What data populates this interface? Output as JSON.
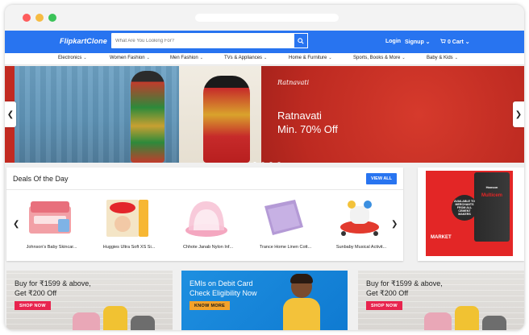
{
  "header": {
    "logo_text": "FlipkartClone",
    "search_placeholder": "What Are You Looking For?",
    "login_label": "Login",
    "signup_label": "Signup",
    "signup_chevron": "⌄",
    "cart_icon": "🛒",
    "cart_label": "0 Cart"
  },
  "categories": [
    {
      "label": "Electronics"
    },
    {
      "label": "Women Fashion"
    },
    {
      "label": "Men Fashion"
    },
    {
      "label": "TVs & Appliances"
    },
    {
      "label": "Home & Furniture"
    },
    {
      "label": "Sports, Books & More"
    },
    {
      "label": "Baby & Kids"
    }
  ],
  "hero": {
    "brand": "Ratnavati",
    "title": "Ratnavati",
    "subtitle": "Min. 70% Off",
    "slide_count": 4,
    "active_slide": 1
  },
  "deals": {
    "title": "Deals Of the Day",
    "view_all_label": "VIEW ALL",
    "items": [
      {
        "name": "Johnson's Baby Skincar..."
      },
      {
        "name": "Huggies Ultra Soft XS Si..."
      },
      {
        "name": "Chhote Janab Nylon Inf..."
      },
      {
        "name": "Trance Home Linen Cott..."
      },
      {
        "name": "Sunbaby Musical Activit..."
      }
    ]
  },
  "side_ad": {
    "bag_label": "Hanson",
    "bag_brand": "Multicem",
    "circle_text": "AVAILABLE TO MERCHANTS FROM ALL CEMENT MAKERS",
    "market_label": "MARKET"
  },
  "banners": [
    {
      "line1": "Buy for ₹1599 & above,",
      "line2": "Get ₹200 Off",
      "button": "SHOP NOW"
    },
    {
      "line1": "EMIs on Debit Card",
      "line2": "Check Eligibility Now",
      "button": "KNOW MORE"
    },
    {
      "line1": "Buy for ₹1599 & above,",
      "line2": "Get ₹200 Off",
      "button": "SHOP NOW"
    }
  ],
  "colors": {
    "brand_blue": "#2874f0",
    "hero_red": "#c22a21",
    "shop_now_pink": "#e8244e",
    "know_more_orange": "#f3a22b"
  }
}
